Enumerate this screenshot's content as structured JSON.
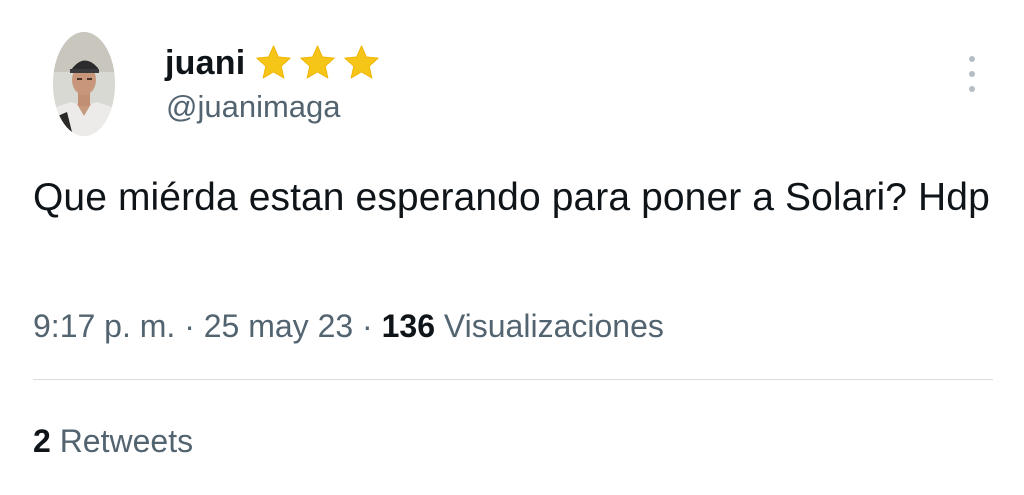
{
  "author": {
    "display_name": "juani",
    "handle": "@juanimaga",
    "badge_icons": [
      "star-icon",
      "star-icon",
      "star-icon"
    ],
    "star_color": "#f5c518"
  },
  "tweet": {
    "text": "Que miérda estan esperando para poner a Solari? Hdp",
    "time": "9:17 p. m.",
    "separator": "·",
    "date": "25 may 23",
    "views_count": "136",
    "views_label": "Visualizaciones"
  },
  "stats": {
    "retweets_count": "2",
    "retweets_label": "Retweets"
  },
  "icons": {
    "more": "more-options-icon"
  },
  "colors": {
    "text_primary": "#0f1419",
    "text_secondary": "#536471",
    "divider": "#d9dde1"
  }
}
